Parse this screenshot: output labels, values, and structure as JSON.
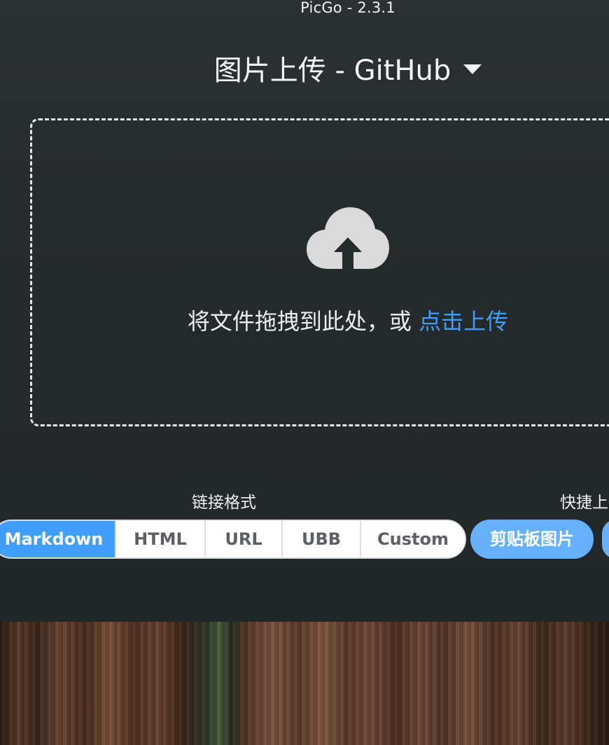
{
  "window": {
    "title": "PicGo - 2.3.1"
  },
  "picbed": {
    "title": "图片上传 - GitHub",
    "dropdown_icon": "caret-down-icon"
  },
  "upload": {
    "icon": "cloud-upload-icon",
    "hint_text": "将文件拖拽到此处，或 ",
    "click_text": "点击上传"
  },
  "link_format": {
    "label": "链接格式",
    "options": [
      "Markdown",
      "HTML",
      "URL",
      "UBB",
      "Custom"
    ],
    "selected": "Markdown"
  },
  "quick_upload": {
    "label": "快捷上",
    "clipboard_button": "剪贴板图片"
  },
  "colors": {
    "accent": "#409eff",
    "button": "#66b1ff",
    "background": "#2b3032"
  }
}
